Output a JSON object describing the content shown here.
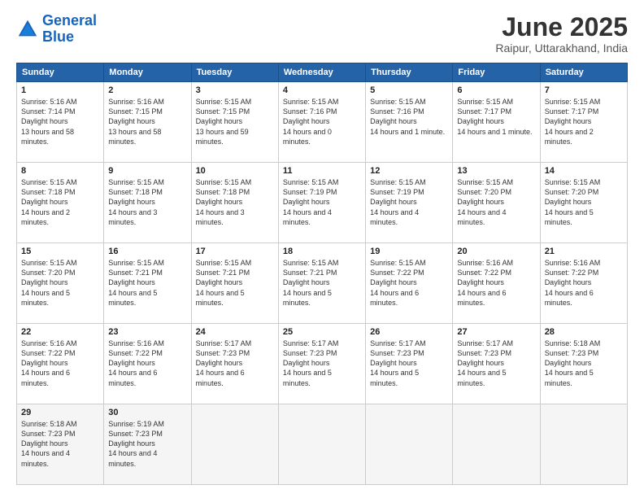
{
  "header": {
    "logo_line1": "General",
    "logo_line2": "Blue",
    "title": "June 2025",
    "subtitle": "Raipur, Uttarakhand, India"
  },
  "calendar": {
    "days_of_week": [
      "Sunday",
      "Monday",
      "Tuesday",
      "Wednesday",
      "Thursday",
      "Friday",
      "Saturday"
    ],
    "weeks": [
      [
        null,
        {
          "day": "2",
          "sunrise": "5:16 AM",
          "sunset": "7:15 PM",
          "daylight": "13 hours and 58 minutes."
        },
        {
          "day": "3",
          "sunrise": "5:15 AM",
          "sunset": "7:15 PM",
          "daylight": "13 hours and 59 minutes."
        },
        {
          "day": "4",
          "sunrise": "5:15 AM",
          "sunset": "7:16 PM",
          "daylight": "14 hours and 0 minutes."
        },
        {
          "day": "5",
          "sunrise": "5:15 AM",
          "sunset": "7:16 PM",
          "daylight": "14 hours and 1 minute."
        },
        {
          "day": "6",
          "sunrise": "5:15 AM",
          "sunset": "7:17 PM",
          "daylight": "14 hours and 1 minute."
        },
        {
          "day": "7",
          "sunrise": "5:15 AM",
          "sunset": "7:17 PM",
          "daylight": "14 hours and 2 minutes."
        }
      ],
      [
        {
          "day": "1",
          "sunrise": "5:16 AM",
          "sunset": "7:14 PM",
          "daylight": "13 hours and 58 minutes."
        },
        {
          "day": "9",
          "sunrise": "5:15 AM",
          "sunset": "7:18 PM",
          "daylight": "14 hours and 3 minutes."
        },
        {
          "day": "10",
          "sunrise": "5:15 AM",
          "sunset": "7:18 PM",
          "daylight": "14 hours and 3 minutes."
        },
        {
          "day": "11",
          "sunrise": "5:15 AM",
          "sunset": "7:19 PM",
          "daylight": "14 hours and 4 minutes."
        },
        {
          "day": "12",
          "sunrise": "5:15 AM",
          "sunset": "7:19 PM",
          "daylight": "14 hours and 4 minutes."
        },
        {
          "day": "13",
          "sunrise": "5:15 AM",
          "sunset": "7:20 PM",
          "daylight": "14 hours and 4 minutes."
        },
        {
          "day": "14",
          "sunrise": "5:15 AM",
          "sunset": "7:20 PM",
          "daylight": "14 hours and 5 minutes."
        }
      ],
      [
        {
          "day": "8",
          "sunrise": "5:15 AM",
          "sunset": "7:18 PM",
          "daylight": "14 hours and 2 minutes."
        },
        {
          "day": "16",
          "sunrise": "5:15 AM",
          "sunset": "7:21 PM",
          "daylight": "14 hours and 5 minutes."
        },
        {
          "day": "17",
          "sunrise": "5:15 AM",
          "sunset": "7:21 PM",
          "daylight": "14 hours and 5 minutes."
        },
        {
          "day": "18",
          "sunrise": "5:15 AM",
          "sunset": "7:21 PM",
          "daylight": "14 hours and 5 minutes."
        },
        {
          "day": "19",
          "sunrise": "5:15 AM",
          "sunset": "7:22 PM",
          "daylight": "14 hours and 6 minutes."
        },
        {
          "day": "20",
          "sunrise": "5:16 AM",
          "sunset": "7:22 PM",
          "daylight": "14 hours and 6 minutes."
        },
        {
          "day": "21",
          "sunrise": "5:16 AM",
          "sunset": "7:22 PM",
          "daylight": "14 hours and 6 minutes."
        }
      ],
      [
        {
          "day": "15",
          "sunrise": "5:15 AM",
          "sunset": "7:20 PM",
          "daylight": "14 hours and 5 minutes."
        },
        {
          "day": "23",
          "sunrise": "5:16 AM",
          "sunset": "7:22 PM",
          "daylight": "14 hours and 6 minutes."
        },
        {
          "day": "24",
          "sunrise": "5:17 AM",
          "sunset": "7:23 PM",
          "daylight": "14 hours and 6 minutes."
        },
        {
          "day": "25",
          "sunrise": "5:17 AM",
          "sunset": "7:23 PM",
          "daylight": "14 hours and 5 minutes."
        },
        {
          "day": "26",
          "sunrise": "5:17 AM",
          "sunset": "7:23 PM",
          "daylight": "14 hours and 5 minutes."
        },
        {
          "day": "27",
          "sunrise": "5:17 AM",
          "sunset": "7:23 PM",
          "daylight": "14 hours and 5 minutes."
        },
        {
          "day": "28",
          "sunrise": "5:18 AM",
          "sunset": "7:23 PM",
          "daylight": "14 hours and 5 minutes."
        }
      ],
      [
        {
          "day": "22",
          "sunrise": "5:16 AM",
          "sunset": "7:22 PM",
          "daylight": "14 hours and 6 minutes."
        },
        {
          "day": "30",
          "sunrise": "5:19 AM",
          "sunset": "7:23 PM",
          "daylight": "14 hours and 4 minutes."
        },
        null,
        null,
        null,
        null,
        null
      ],
      [
        {
          "day": "29",
          "sunrise": "5:18 AM",
          "sunset": "7:23 PM",
          "daylight": "14 hours and 4 minutes."
        },
        null,
        null,
        null,
        null,
        null,
        null
      ]
    ]
  }
}
